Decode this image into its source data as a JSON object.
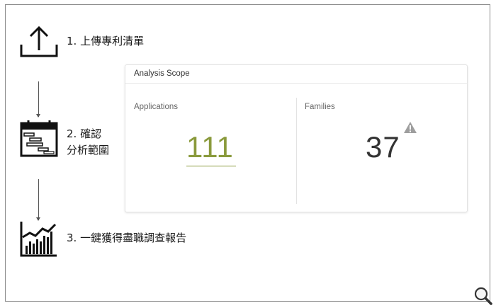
{
  "steps": [
    {
      "label": "1. 上傳專利清單",
      "icon": "upload-icon"
    },
    {
      "label_line1": "2. 確認",
      "label_line2": "分析範圍",
      "icon": "calendar-gantt-icon"
    },
    {
      "label": "3. 一鍵獲得盡職調查報告",
      "icon": "rising-chart-icon"
    }
  ],
  "card": {
    "title": "Analysis Scope",
    "applications": {
      "label": "Applications",
      "value": "111"
    },
    "families": {
      "label": "Families",
      "value": "37",
      "status_icon": "warning-icon"
    }
  },
  "colors": {
    "accent": "#8a9a3c",
    "warning": "#9e9e9e",
    "border": "#8a8a8a"
  },
  "corner_icon": "zoom-icon"
}
